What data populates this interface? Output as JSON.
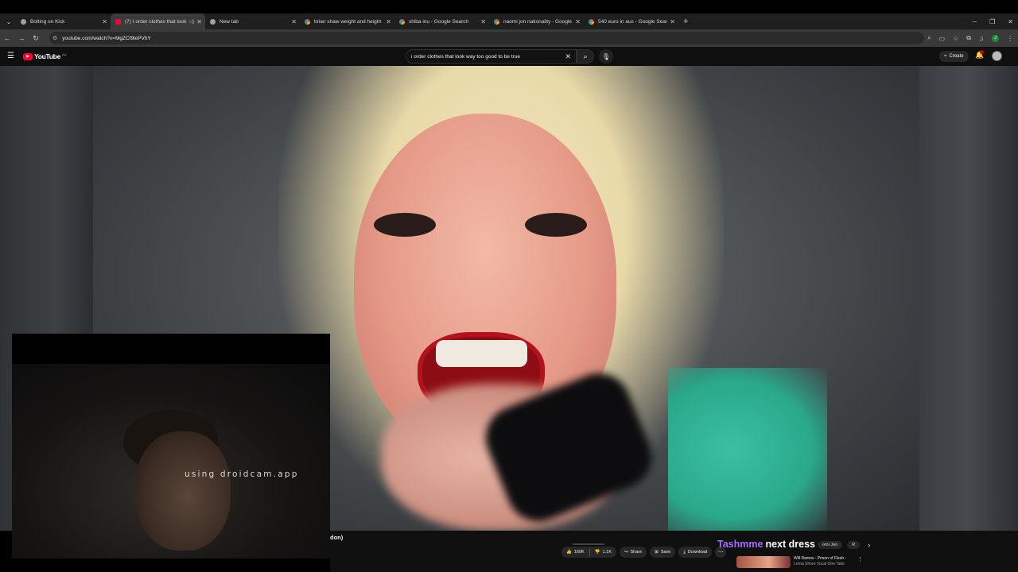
{
  "browser": {
    "tabs": [
      {
        "label": "Botting on Kick",
        "favicon": "globe-icon",
        "active": false
      },
      {
        "label": "(7) I order clothes that look",
        "favicon": "youtube-icon",
        "active": true
      },
      {
        "label": "New tab",
        "favicon": "chrome-icon",
        "active": false
      },
      {
        "label": "brian shaw weight and height",
        "favicon": "google-icon",
        "active": false
      },
      {
        "label": "shiba inu - Google Search",
        "favicon": "google-icon",
        "active": false
      },
      {
        "label": "naomi jon nationality - Google",
        "favicon": "google-icon",
        "active": false
      },
      {
        "label": "540 euro in aus - Google Search",
        "favicon": "google-icon",
        "active": false
      }
    ],
    "url": "youtube.com/watch?v=MgZCf9lePVhY",
    "profile_initial": "J"
  },
  "youtube": {
    "logo_text": "YouTube",
    "country_code": "AU",
    "search_query": "i order clothes that look way too good to be true",
    "create_label": "Create",
    "notification_count": "9+"
  },
  "webcam": {
    "watermark": "using droidcam.app"
  },
  "video_info": {
    "title_fragment": "don)",
    "likes": "160K",
    "dislikes": "1.1K",
    "share_label": "Share",
    "save_label": "Save",
    "download_label": "Download"
  },
  "overlay": {
    "name_text": "Tashmme",
    "caption_text": "next dress"
  },
  "chips": [
    "omi Jon",
    "R"
  ],
  "recommendation": {
    "title_line1": "Will Ramos - Prison of Flesh -",
    "title_line2": "Lorna Shore Vocal One Take"
  },
  "colors": {
    "youtube_red": "#ff0033",
    "overlay_purple": "#a56bff",
    "shirt_teal": "#2aa88a"
  }
}
